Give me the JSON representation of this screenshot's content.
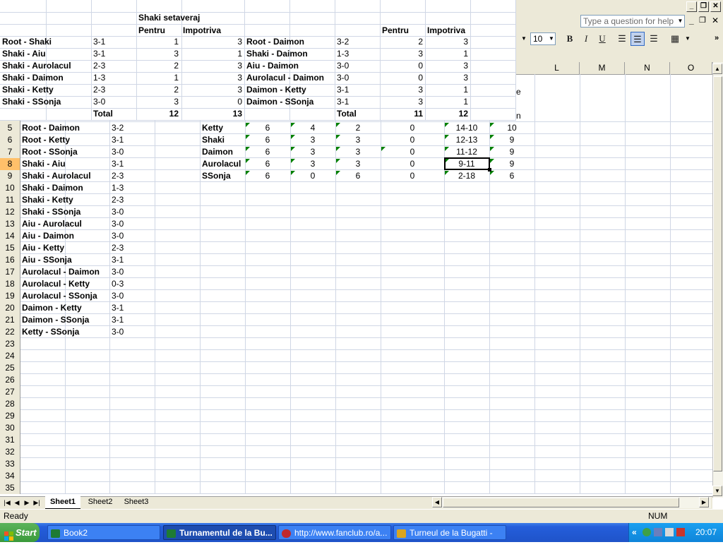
{
  "toolbar": {
    "help_placeholder": "Type a question for help",
    "font_size": "10",
    "bold": "B",
    "italic": "I",
    "underline": "U"
  },
  "columns": [
    "L",
    "M",
    "N",
    "O"
  ],
  "rows": [
    "5",
    "6",
    "7",
    "8",
    "9",
    "10",
    "11",
    "12",
    "13",
    "14",
    "15",
    "16",
    "17",
    "18",
    "19",
    "20",
    "21",
    "22",
    "23",
    "24",
    "25",
    "26",
    "27",
    "28",
    "29",
    "30",
    "31",
    "32",
    "33",
    "34",
    "35"
  ],
  "matches": [
    {
      "pair": "Root - Daimon",
      "score": "3-2"
    },
    {
      "pair": "Root - Ketty",
      "score": "3-1"
    },
    {
      "pair": "Root - SSonja",
      "score": "3-0"
    },
    {
      "pair": "Shaki - Aiu",
      "score": "3-1"
    },
    {
      "pair": "Shaki - Aurolacul",
      "score": "2-3"
    },
    {
      "pair": "Shaki - Daimon",
      "score": "1-3"
    },
    {
      "pair": "Shaki - Ketty",
      "score": "2-3"
    },
    {
      "pair": "Shaki - SSonja",
      "score": "3-0"
    },
    {
      "pair": "Aiu - Aurolacul",
      "score": "3-0"
    },
    {
      "pair": "Aiu - Daimon",
      "score": "3-0"
    },
    {
      "pair": "Aiu - Ketty",
      "score": "2-3"
    },
    {
      "pair": "Aiu - SSonja",
      "score": "3-1"
    },
    {
      "pair": "Aurolacul - Daimon",
      "score": "3-0"
    },
    {
      "pair": "Aurolacul - Ketty",
      "score": "0-3"
    },
    {
      "pair": "Aurolacul - SSonja",
      "score": "3-0"
    },
    {
      "pair": "Daimon - Ketty",
      "score": "3-1"
    },
    {
      "pair": "Daimon - SSonja",
      "score": "3-1"
    },
    {
      "pair": "Ketty - SSonja",
      "score": "3-0"
    }
  ],
  "standings": [
    {
      "team": "Ketty",
      "c1": "6",
      "c2": "4",
      "c3": "2",
      "c4": "0",
      "sets": "14-10",
      "pts": "10"
    },
    {
      "team": "Shaki",
      "c1": "6",
      "c2": "3",
      "c3": "3",
      "c4": "0",
      "sets": "12-13",
      "pts": "9"
    },
    {
      "team": "Daimon",
      "c1": "6",
      "c2": "3",
      "c3": "3",
      "c4": "0",
      "sets": "11-12",
      "pts": "9"
    },
    {
      "team": "Aurolacul",
      "c1": "6",
      "c2": "3",
      "c3": "3",
      "c4": "0",
      "sets": "9-11",
      "pts": "9"
    },
    {
      "team": "SSonja",
      "c1": "6",
      "c2": "0",
      "c3": "6",
      "c4": "0",
      "sets": "2-18",
      "pts": "6"
    }
  ],
  "overlay": {
    "title": "Shaki setaveraj",
    "pentru": "Pentru",
    "impotriva": "Impotriva",
    "total": "Total",
    "left_rows": [
      {
        "pair": "Root - Shaki",
        "score": "3-1",
        "p": "1",
        "i": "3"
      },
      {
        "pair": "Shaki - Aiu",
        "score": "3-1",
        "p": "3",
        "i": "1"
      },
      {
        "pair": "Shaki - Aurolacul",
        "score": "2-3",
        "p": "2",
        "i": "3"
      },
      {
        "pair": "Shaki - Daimon",
        "score": "1-3",
        "p": "1",
        "i": "3"
      },
      {
        "pair": "Shaki - Ketty",
        "score": "2-3",
        "p": "2",
        "i": "3"
      },
      {
        "pair": "Shaki - SSonja",
        "score": "3-0",
        "p": "3",
        "i": "0"
      }
    ],
    "left_total_p": "12",
    "left_total_i": "13",
    "right_rows": [
      {
        "pair": "Root - Daimon",
        "score": "3-2",
        "p": "2",
        "i": "3"
      },
      {
        "pair": "Shaki - Daimon",
        "score": "1-3",
        "p": "3",
        "i": "1"
      },
      {
        "pair": "Aiu - Daimon",
        "score": "3-0",
        "p": "0",
        "i": "3"
      },
      {
        "pair": "Aurolacul - Daimon",
        "score": "3-0",
        "p": "0",
        "i": "3"
      },
      {
        "pair": "Daimon - Ketty",
        "score": "3-1",
        "p": "3",
        "i": "1"
      },
      {
        "pair": "Daimon - SSonja",
        "score": "3-1",
        "p": "3",
        "i": "1"
      }
    ],
    "right_total_p": "11",
    "right_total_i": "12",
    "partial_e": "e",
    "partial_n": "n"
  },
  "sheets": [
    "Sheet1",
    "Sheet2",
    "Sheet3"
  ],
  "status": {
    "ready": "Ready",
    "num": "NUM"
  },
  "taskbar": {
    "start": "Start",
    "items": [
      "Book2",
      "Turnamentul de la Bu...",
      "http://www.fanclub.ro/a...",
      "Turneul de la Bugatti - Gr..."
    ],
    "clock": "20:07"
  }
}
